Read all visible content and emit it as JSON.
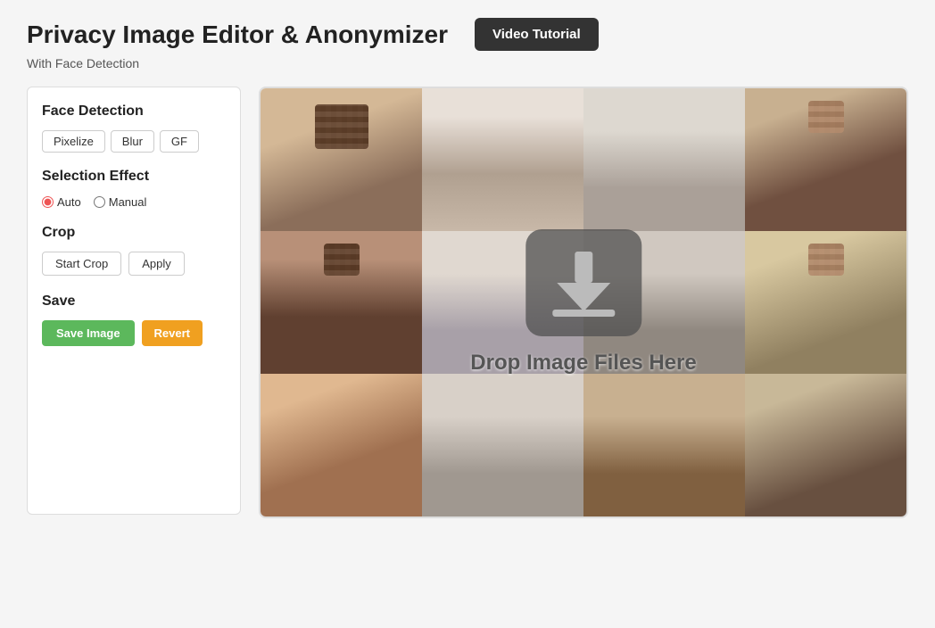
{
  "header": {
    "title": "Privacy Image Editor &  Anonymizer",
    "video_btn": "Video Tutorial",
    "subtitle": "With Face Detection"
  },
  "sidebar": {
    "face_detection": {
      "title": "Face Detection",
      "buttons": [
        "Pixelize",
        "Blur",
        "GF"
      ]
    },
    "selection_effect": {
      "title": "Selection Effect",
      "options": [
        {
          "label": "Auto",
          "value": "auto",
          "checked": true
        },
        {
          "label": "Manual",
          "value": "manual",
          "checked": false
        }
      ]
    },
    "crop": {
      "title": "Crop",
      "start_btn": "Start Crop",
      "apply_btn": "Apply"
    },
    "save": {
      "title": "Save",
      "save_btn": "Save Image",
      "revert_btn": "Revert"
    }
  },
  "dropzone": {
    "text": "Drop Image Files Here"
  }
}
